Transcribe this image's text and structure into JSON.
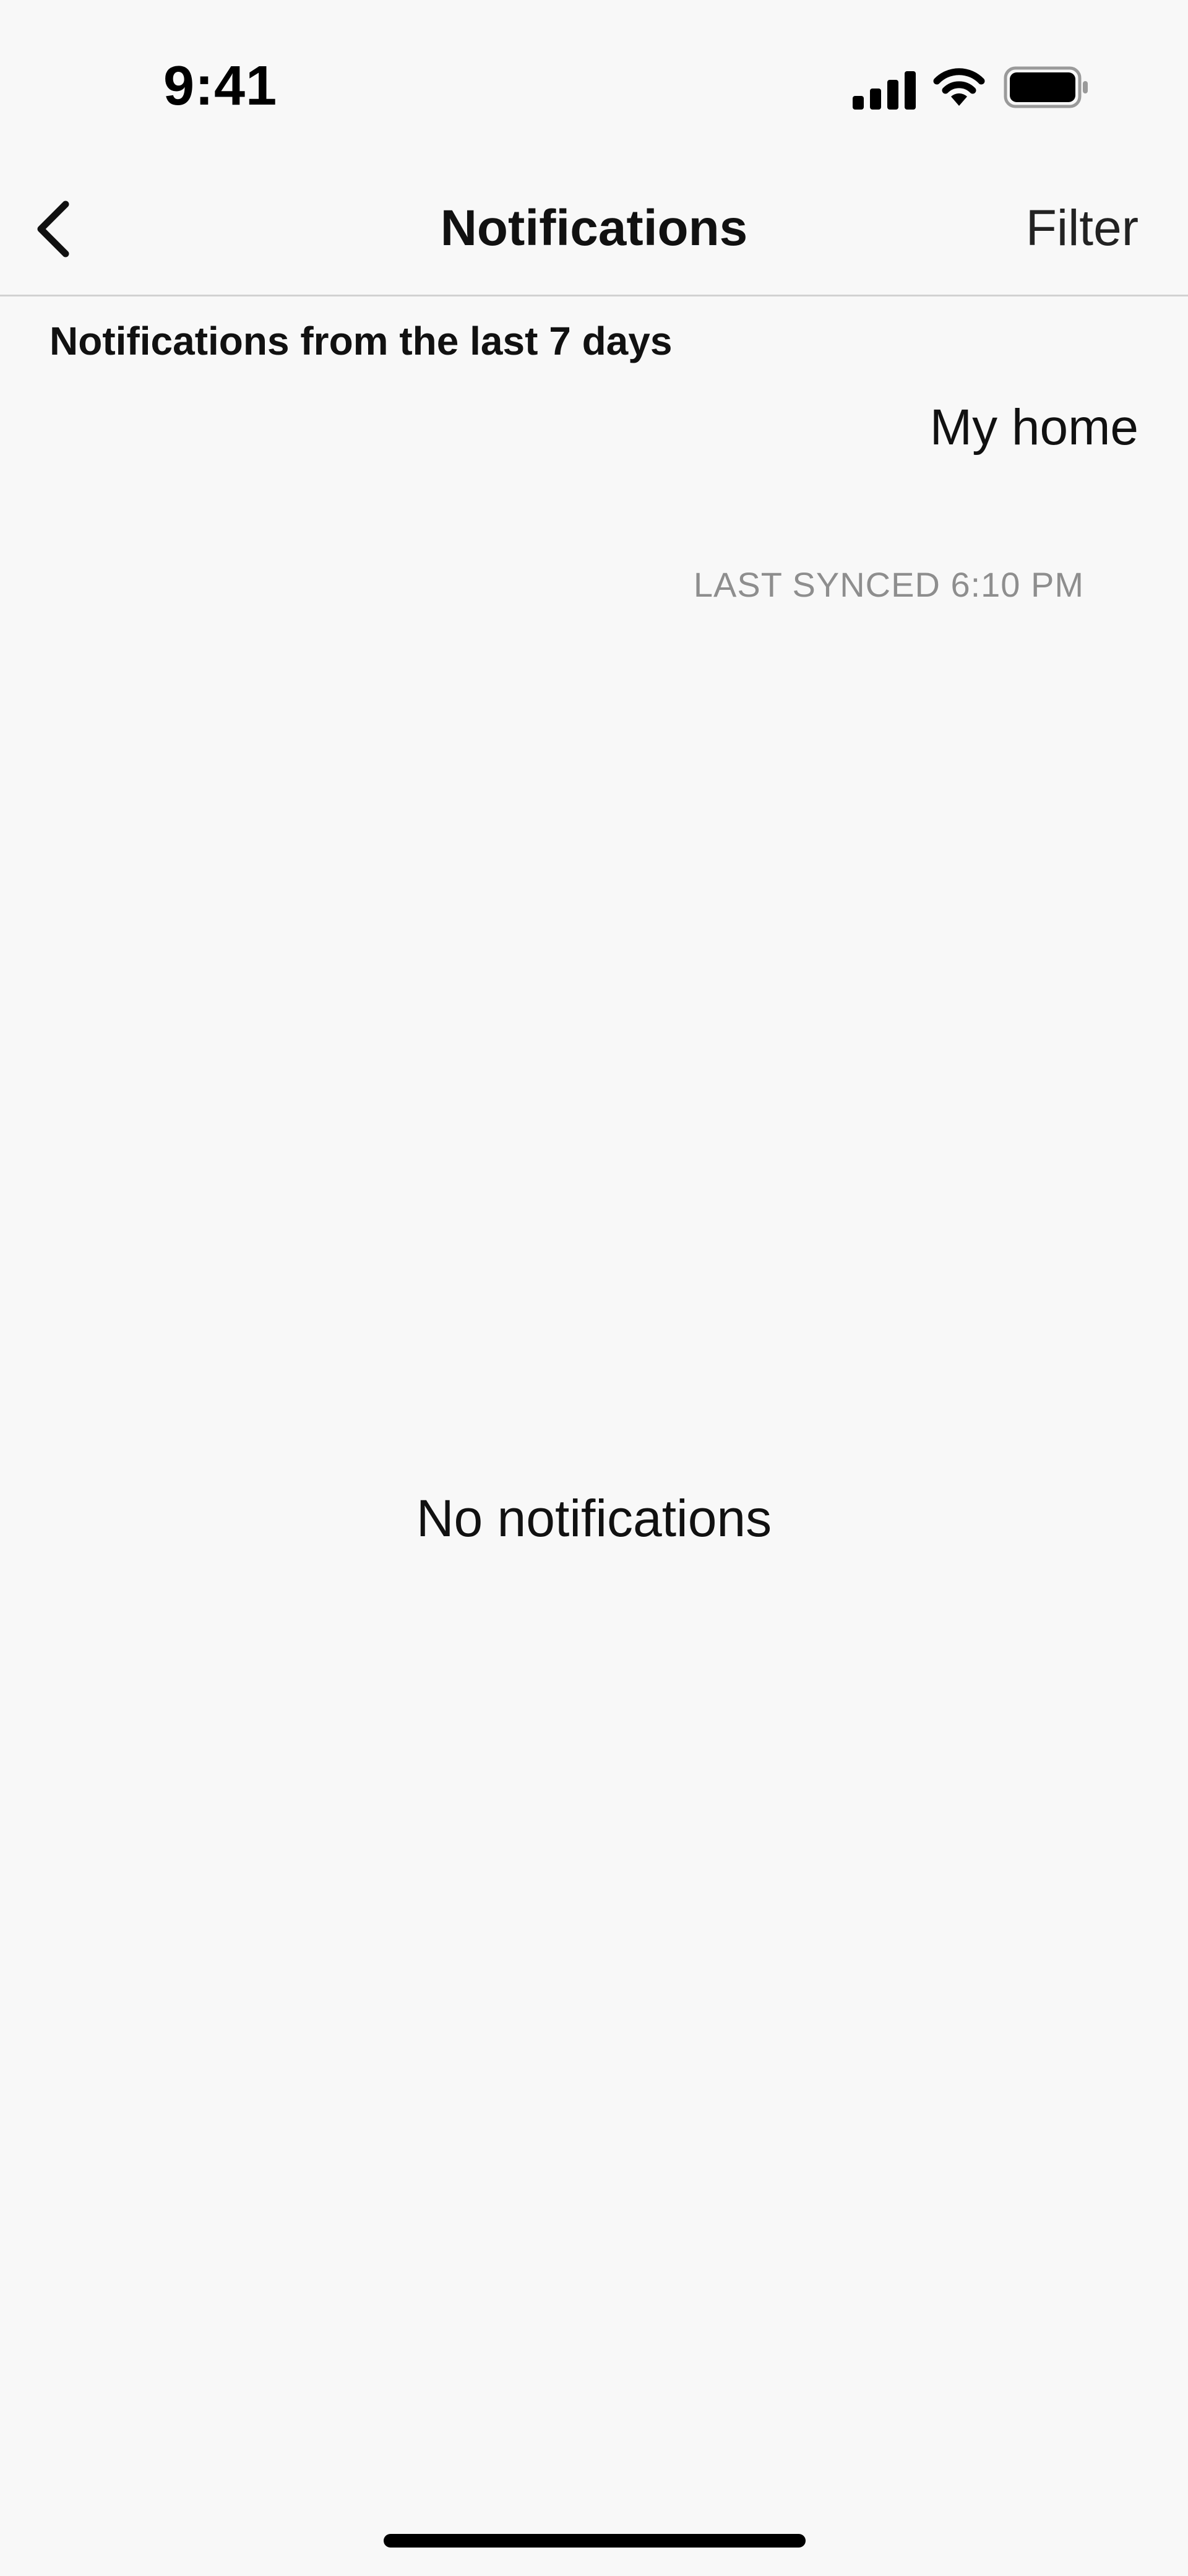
{
  "status_bar": {
    "time": "9:41",
    "signal_icon": "cellular-signal-icon",
    "wifi_icon": "wifi-icon",
    "battery_icon": "battery-icon"
  },
  "nav": {
    "back_icon": "chevron-left-icon",
    "title": "Notifications",
    "filter_label": "Filter"
  },
  "content": {
    "section_heading": "Notifications from the last 7 days",
    "home_name": "My home",
    "last_synced": "LAST SYNCED 6:10 PM",
    "empty_message": "No notifications"
  },
  "colors": {
    "background": "#f8f8f8",
    "text_primary": "#111111",
    "text_secondary": "#8e8e8e",
    "divider": "#d2d2d2"
  }
}
